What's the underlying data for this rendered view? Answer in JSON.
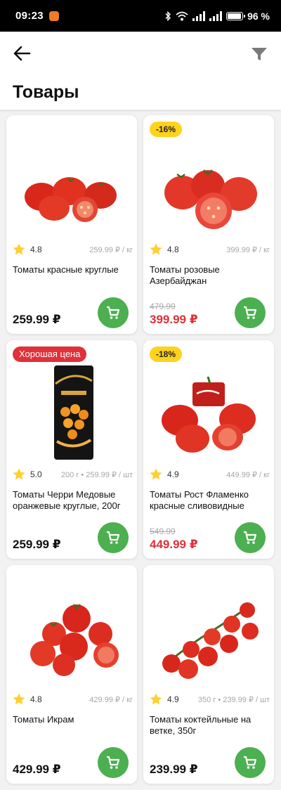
{
  "status": {
    "time": "09:23",
    "battery": "96 %",
    "battery_level": 0.96
  },
  "header": {
    "title": "Товары",
    "back_icon": "arrow-left-icon",
    "filter_icon": "filter-icon"
  },
  "colors": {
    "accent_green": "#4caf50",
    "sale_red": "#e0303a",
    "badge_yellow": "#ffd21e",
    "star": "#ffcf2e"
  },
  "products": [
    {
      "badge": "",
      "rating": "4.8",
      "unit_price": "259.99 ₽ / кг",
      "name": "Томаты красные круглые",
      "old_price": "",
      "price": "259.99 ₽"
    },
    {
      "badge": "-16%",
      "rating": "4.8",
      "unit_price": "399.99 ₽ / кг",
      "name": "Томаты розовые Азербайджан",
      "old_price": "479.99",
      "price": "399.99 ₽"
    },
    {
      "badge": "Хорошая цена",
      "rating": "5.0",
      "unit_price": "200 г • 259.99 ₽ / шт",
      "name": "Томаты Черри Медовые оранжевые круглые, 200г",
      "old_price": "",
      "price": "259.99 ₽"
    },
    {
      "badge": "-18%",
      "rating": "4.9",
      "unit_price": "449.99 ₽ / кг",
      "name": "Томаты Рост Фламенко красные сливовидные",
      "old_price": "549.99",
      "price": "449.99 ₽"
    },
    {
      "badge": "",
      "rating": "4.8",
      "unit_price": "429.99 ₽ / кг",
      "name": "Томаты Икрам",
      "old_price": "",
      "price": "429.99 ₽"
    },
    {
      "badge": "",
      "rating": "4.9",
      "unit_price": "350 г • 239.99 ₽ / шт",
      "name": "Томаты коктейльные на ветке, 350г",
      "old_price": "",
      "price": "239.99 ₽"
    }
  ]
}
